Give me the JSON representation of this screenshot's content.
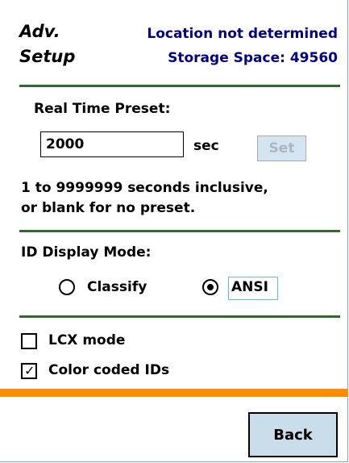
{
  "header": {
    "title_line1": "Adv.",
    "title_line2": "Setup",
    "location": "Location not determined",
    "storage": "Storage Space: 49560"
  },
  "preset": {
    "label": "Real Time Preset:",
    "value": "2000",
    "unit": "sec",
    "set_label": "Set",
    "help_line1": "1 to 9999999 seconds inclusive,",
    "help_line2": "or blank for no preset."
  },
  "id_display": {
    "label": "ID Display Mode:",
    "options": [
      "Classify",
      "ANSI"
    ],
    "selected": "ANSI"
  },
  "options": {
    "lcx_label": "LCX mode",
    "lcx_checked": false,
    "color_label": "Color coded IDs",
    "color_checked": true
  },
  "footer": {
    "back_label": "Back"
  },
  "colors": {
    "header_text": "#00008b",
    "divider": "#2f6b2f",
    "orange_bar": "#ff8c00"
  }
}
